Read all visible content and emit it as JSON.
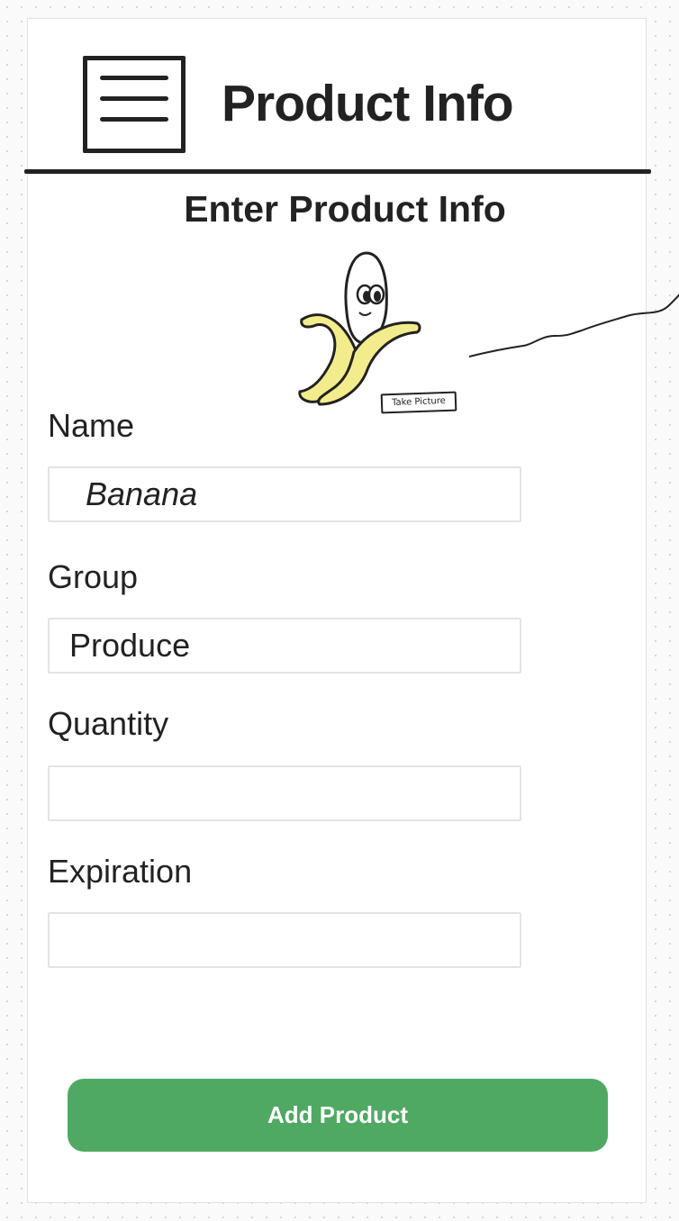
{
  "header": {
    "title": "Product Info",
    "menu_icon": "hamburger-menu-icon"
  },
  "form": {
    "heading": "Enter Product Info",
    "camera": {
      "icon": "banana-camera-icon",
      "take_picture_label": "Take Picture"
    },
    "fields": [
      {
        "label": "Name",
        "value": "Banana"
      },
      {
        "label": "Group",
        "value": "Produce"
      },
      {
        "label": "Quantity",
        "value": ""
      },
      {
        "label": "Expiration",
        "value": ""
      }
    ],
    "submit_label": "Add Product"
  },
  "colors": {
    "primary_button": "#4fa963",
    "banana_yellow": "#f3ec8c",
    "ink": "#222222"
  }
}
